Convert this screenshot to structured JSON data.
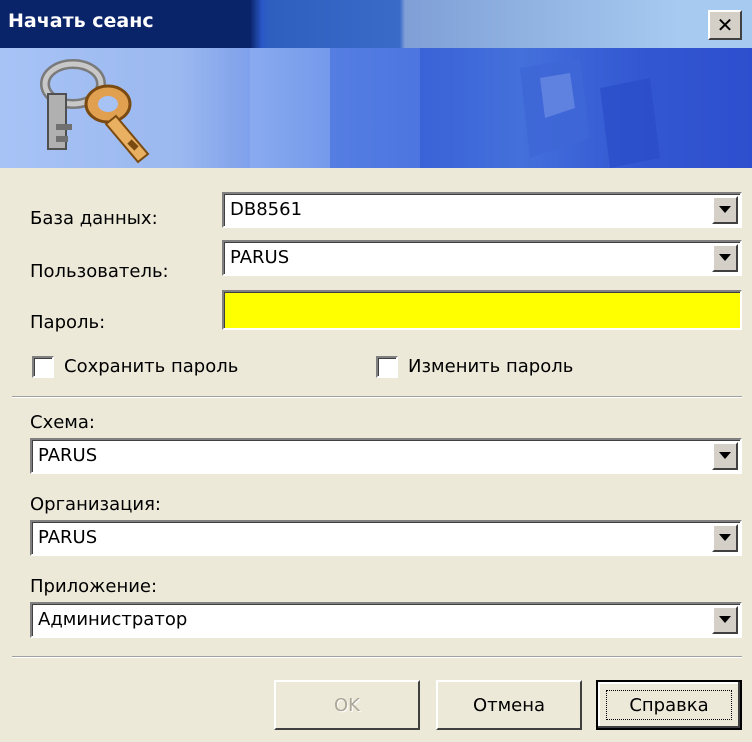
{
  "window": {
    "title": "Начать сеанс",
    "close_glyph": "✕"
  },
  "login": {
    "database_label": "База данных:",
    "database_value": "DB8561",
    "user_label": "Пользователь:",
    "user_value": "PARUS",
    "password_label": "Пароль:",
    "password_value": "",
    "save_password_label": "Сохранить пароль",
    "save_password_checked": false,
    "change_password_label": "Изменить пароль",
    "change_password_checked": false
  },
  "context": {
    "schema_label": "Схема:",
    "schema_value": "PARUS",
    "organization_label": "Организация:",
    "organization_value": "PARUS",
    "application_label": "Приложение:",
    "application_value": "Администратор"
  },
  "buttons": {
    "ok": "OK",
    "cancel": "Отмена",
    "help": "Справка"
  },
  "icons": {
    "banner": "keys-icon",
    "dropdown": "triangle-down-icon"
  },
  "colors": {
    "title_bar": "#0a246a",
    "password_bg": "#ffff00",
    "dialog_bg": "#ece9d8"
  }
}
